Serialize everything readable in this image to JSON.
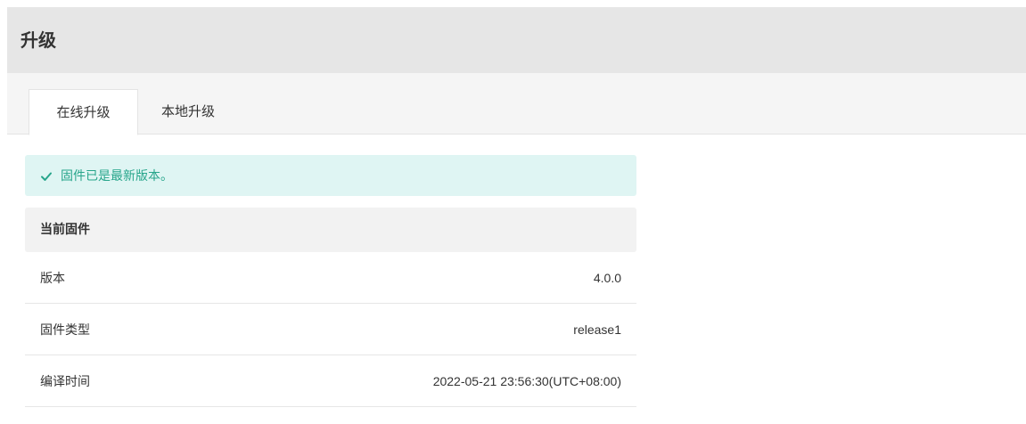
{
  "header": {
    "title": "升级"
  },
  "tabs": [
    {
      "label": "在线升级",
      "active": true
    },
    {
      "label": "本地升级",
      "active": false
    }
  ],
  "alert": {
    "icon": "check-icon",
    "text": "固件已是最新版本。",
    "color": "#27a58b",
    "background": "#dff5f3"
  },
  "current_firmware": {
    "section_title": "当前固件",
    "rows": [
      {
        "label": "版本",
        "value": "4.0.0"
      },
      {
        "label": "固件类型",
        "value": "release1"
      },
      {
        "label": "编译时间",
        "value": "2022-05-21 23:56:30(UTC+08:00)"
      }
    ]
  }
}
